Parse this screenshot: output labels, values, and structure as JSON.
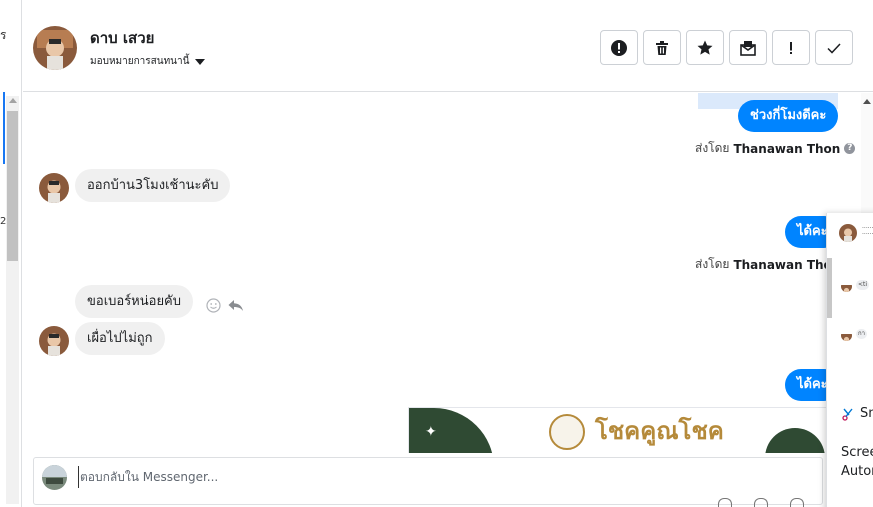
{
  "left_strip": {
    "top_char": "ร",
    "mid_char": "2"
  },
  "header": {
    "contact_name": "ดาบ เสวย",
    "assign_label": "มอบหมายการสนทนานี้"
  },
  "actions": [
    {
      "name": "spam-button",
      "icon": "alert-circle-icon"
    },
    {
      "name": "delete-button",
      "icon": "trash-icon"
    },
    {
      "name": "star-button",
      "icon": "star-icon"
    },
    {
      "name": "mark-unread-button",
      "icon": "envelope-icon"
    },
    {
      "name": "follow-up-button",
      "icon": "exclamation-icon"
    },
    {
      "name": "done-button",
      "icon": "check-icon"
    }
  ],
  "messages": {
    "out1": "ช่วงกี่โมงดีคะ",
    "sent_by_1_prefix": "ส่งโดย",
    "sent_by_1_name": "Thanawan Thon",
    "in1": "ออกบ้าน3โมงเช้านะคับ",
    "out2": "ได้คะ",
    "sent_by_2_prefix": "ส่งโดย",
    "sent_by_2_name": "Thanawan Thon",
    "in2": "ขอเบอร์หน่อยคับ",
    "in3": "เผื่อไปไม่ถูก",
    "out3": "ได้คะ"
  },
  "image_preview": {
    "brand_text": "โชคคูณโชค"
  },
  "reply": {
    "placeholder": "ตอบกลับใน Messenger..."
  },
  "side_panel": {
    "top_dots_1": "......",
    "top_dots_2": "......",
    "pill1": "<ti",
    "pill2": "กา",
    "snip_label": "Sn",
    "text1": "Scree",
    "text2": "Autor"
  },
  "colors": {
    "messenger_blue": "#0084ff",
    "incoming_bg": "#f0f0f0",
    "highlight": "#dbe9fb"
  }
}
